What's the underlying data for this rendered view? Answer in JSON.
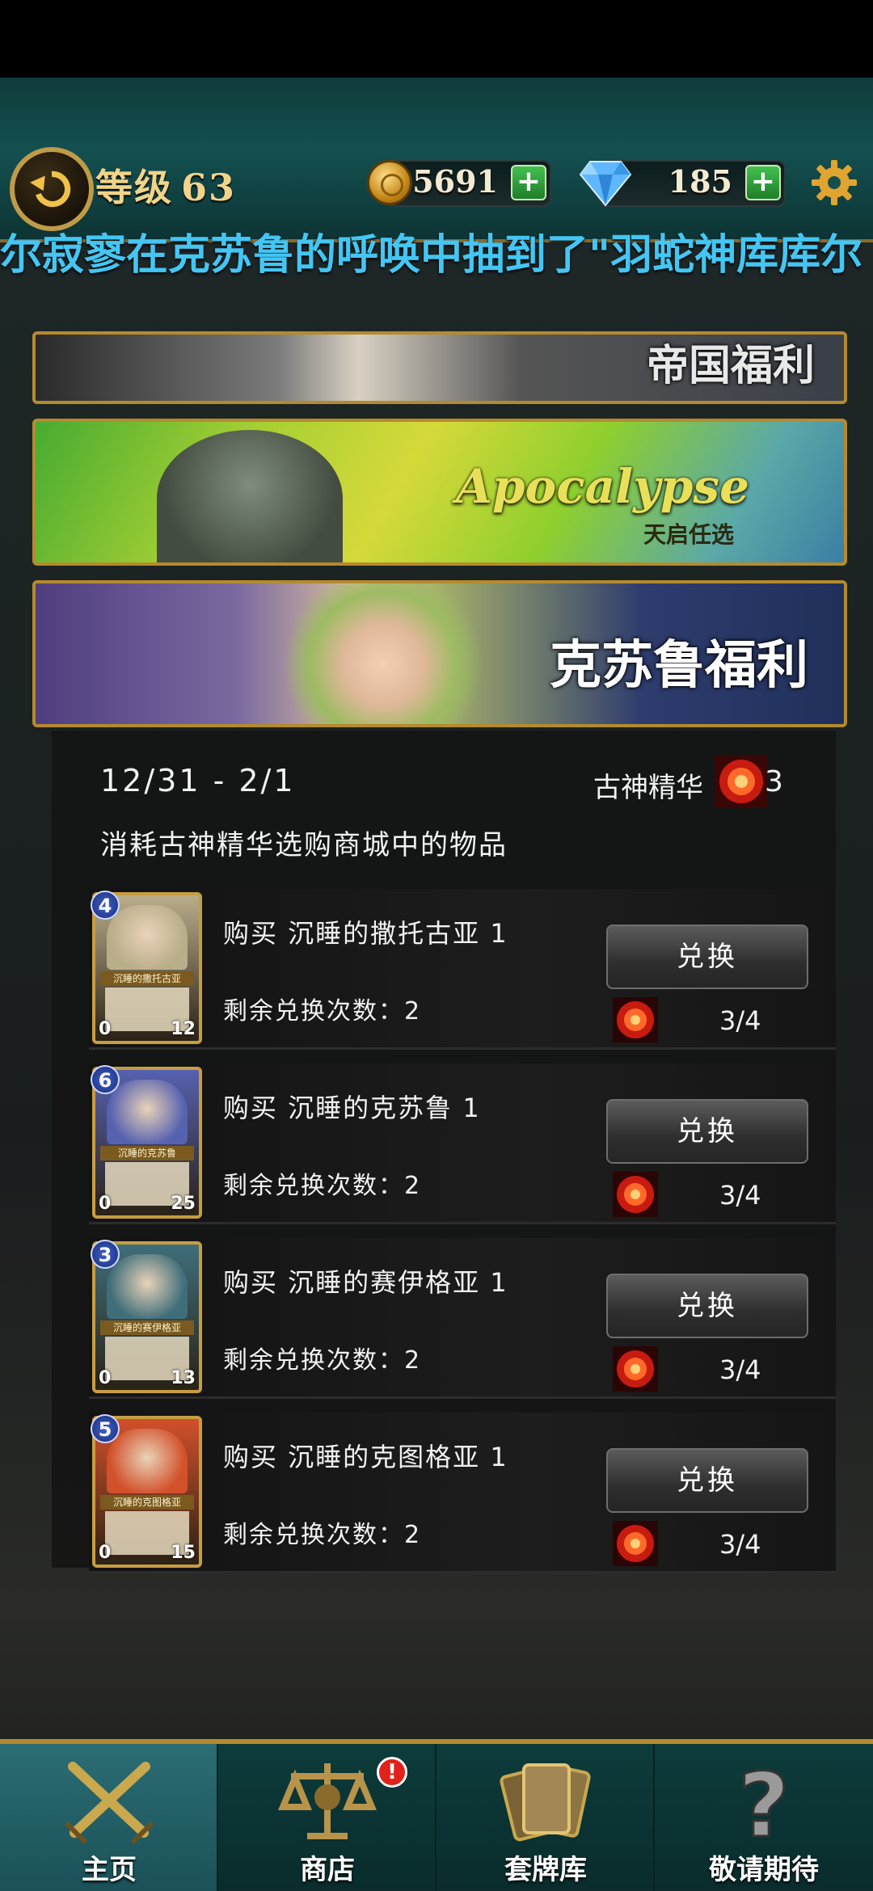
{
  "header": {
    "level_label": "等级",
    "level_value": "63",
    "coins": "5691",
    "gems": "185",
    "plus_symbol": "+"
  },
  "ticker": "尔寂寥在克苏鲁的呼唤中抽到了\"羽蛇神库库尔",
  "banners": [
    {
      "title": "帝国福利"
    },
    {
      "title": "Apocalypse",
      "subtitle": "天启任选"
    },
    {
      "title": "克苏鲁福利"
    }
  ],
  "shop": {
    "date_range": "12/31 - 2/1",
    "essence_label": "古神精华",
    "essence_count": "3",
    "description": "消耗古神精华选购商城中的物品",
    "redeem_label": "兑换",
    "items": [
      {
        "title": "购买 沉睡的撒托古亚 1",
        "remain": "剩余兑换次数：2",
        "cost": "3/4",
        "card": {
          "cost": "4",
          "name": "沉睡的撒托古亚",
          "atk": "0",
          "hp": "12",
          "color": "#b9ad8a"
        }
      },
      {
        "title": "购买 沉睡的克苏鲁 1",
        "remain": "剩余兑换次数：2",
        "cost": "3/4",
        "card": {
          "cost": "6",
          "name": "沉睡的克苏鲁",
          "atk": "0",
          "hp": "25",
          "color": "#5661b0"
        }
      },
      {
        "title": "购买 沉睡的赛伊格亚 1",
        "remain": "剩余兑换次数：2",
        "cost": "3/4",
        "card": {
          "cost": "3",
          "name": "沉睡的赛伊格亚",
          "atk": "0",
          "hp": "13",
          "color": "#3f6e7a"
        }
      },
      {
        "title": "购买 沉睡的克图格亚 1",
        "remain": "剩余兑换次数：2",
        "cost": "3/4",
        "card": {
          "cost": "5",
          "name": "沉睡的克图格亚",
          "atk": "0",
          "hp": "15",
          "color": "#d2502a"
        }
      }
    ]
  },
  "nav": {
    "items": [
      {
        "label": "主页",
        "icon": "crossed-swords-icon"
      },
      {
        "label": "商店",
        "icon": "scales-icon"
      },
      {
        "label": "套牌库",
        "icon": "card-deck-icon"
      },
      {
        "label": "敬请期待",
        "icon": "question-mark-icon"
      }
    ],
    "shop_badge": "!"
  },
  "colors": {
    "gold": "#c09b47",
    "ticker": "#43c6f3",
    "teal": "#145050"
  }
}
